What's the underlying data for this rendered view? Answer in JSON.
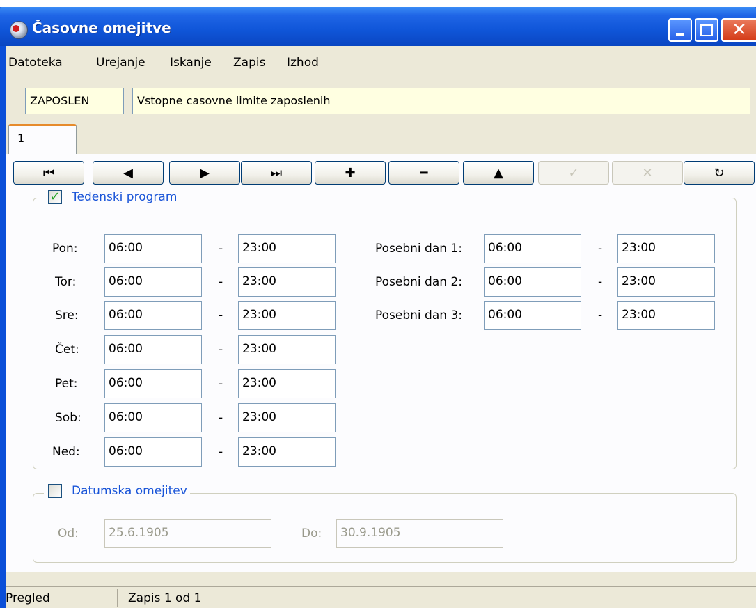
{
  "window": {
    "title": "Časovne omejitve",
    "controls": {
      "minimize": "minimize",
      "maximize": "maximize",
      "close": "✕"
    }
  },
  "menu": [
    {
      "label": "Datoteka"
    },
    {
      "label": "Urejanje"
    },
    {
      "label": "Iskanje"
    },
    {
      "label": "Zapis"
    },
    {
      "label": "Izhod"
    }
  ],
  "header": {
    "code": "ZAPOSLEN",
    "description": "Vstopne casovne limite zaposlenih"
  },
  "tabs": [
    {
      "label": "1"
    }
  ],
  "navbar": {
    "first": "⏮",
    "prev": "◀",
    "next": "▶",
    "last": "⏭",
    "add": "✚",
    "delete": "━",
    "up": "▲",
    "confirm": "✓",
    "cancel": "✕",
    "refresh": "↻"
  },
  "weekly": {
    "legend": "Tedenski program",
    "checked": true,
    "check_glyph": "✓",
    "days": [
      {
        "label": "Pon:",
        "from": "06:00",
        "to": "23:00"
      },
      {
        "label": "Tor:",
        "from": "06:00",
        "to": "23:00"
      },
      {
        "label": "Sre:",
        "from": "06:00",
        "to": "23:00"
      },
      {
        "label": "Čet:",
        "from": "06:00",
        "to": "23:00"
      },
      {
        "label": "Pet:",
        "from": "06:00",
        "to": "23:00"
      },
      {
        "label": "Sob:",
        "from": "06:00",
        "to": "23:00"
      },
      {
        "label": "Ned:",
        "from": "06:00",
        "to": "23:00"
      }
    ],
    "special": [
      {
        "label": "Posebni dan 1:",
        "from": "06:00",
        "to": "23:00"
      },
      {
        "label": "Posebni dan 2:",
        "from": "06:00",
        "to": "23:00"
      },
      {
        "label": "Posebni dan 3:",
        "from": "06:00",
        "to": "23:00"
      }
    ],
    "dash": "-"
  },
  "dates": {
    "legend": "Datumska omejitev",
    "checked": false,
    "from_label": "Od:",
    "from_value": "25.6.1905",
    "to_label": "Do:",
    "to_value": "30.9.1905"
  },
  "status": {
    "mode": "Pregled",
    "record": "Zapis  1  od  1"
  },
  "colors": {
    "titlebar": "#0b4fd8",
    "legend_text": "#1a55d8",
    "header_field_bg": "#ffffe1",
    "tab_accent": "#e68b2c"
  }
}
